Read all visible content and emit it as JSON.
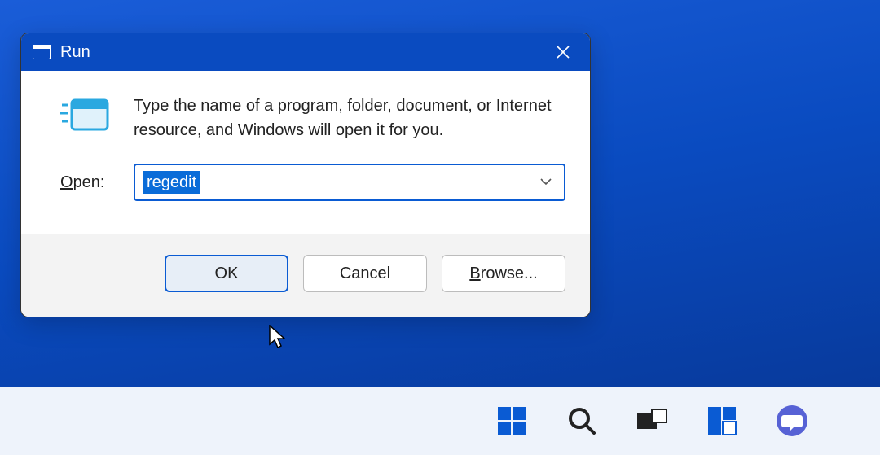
{
  "dialog": {
    "title": "Run",
    "description": "Type the name of a program, folder, document, or Internet resource, and Windows will open it for you.",
    "open_label_pre": "O",
    "open_label_rest": "pen:",
    "input_value": "regedit",
    "buttons": {
      "ok": "OK",
      "cancel": "Cancel",
      "browse_pre": "B",
      "browse_rest": "rowse..."
    }
  }
}
